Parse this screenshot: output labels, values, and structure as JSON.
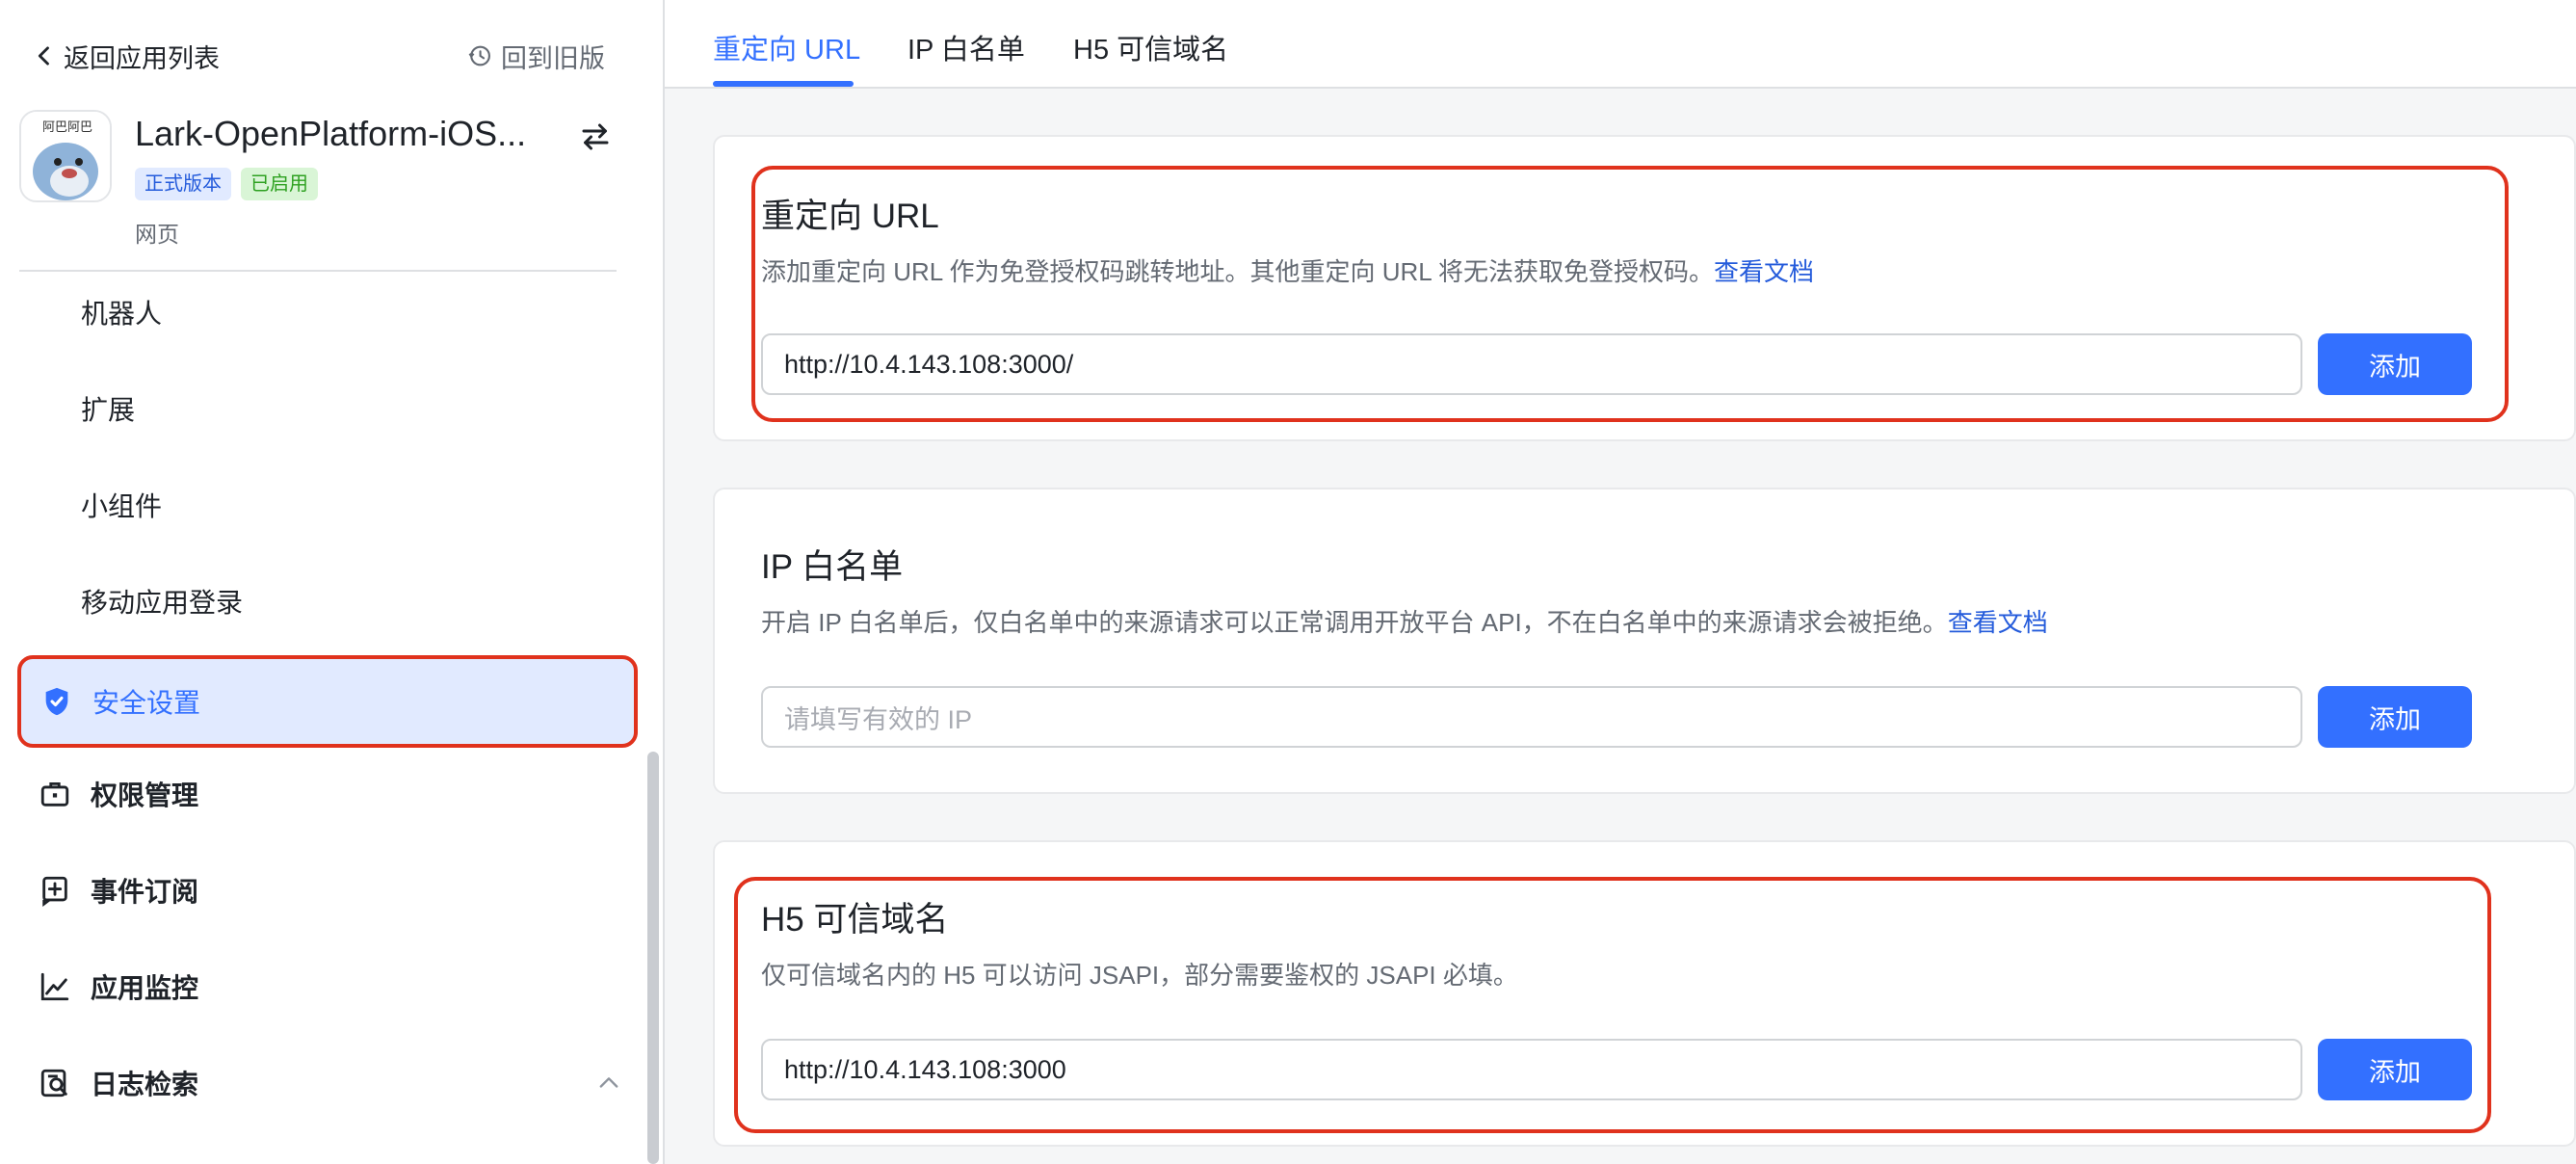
{
  "sidebar": {
    "back_label": "返回应用列表",
    "old_version_label": "回到旧版",
    "app": {
      "name": "Lark-OpenPlatform-iOS...",
      "badge_release": "正式版本",
      "badge_enabled": "已启用",
      "type": "网页"
    },
    "items": [
      {
        "label": "机器人"
      },
      {
        "label": "扩展"
      },
      {
        "label": "小组件"
      },
      {
        "label": "移动应用登录"
      },
      {
        "label": "安全设置",
        "icon": "shield-check-icon",
        "active": true
      },
      {
        "label": "权限管理",
        "icon": "briefcase-icon"
      },
      {
        "label": "事件订阅",
        "icon": "event-add-icon"
      },
      {
        "label": "应用监控",
        "icon": "line-chart-icon"
      },
      {
        "label": "日志检索",
        "icon": "log-search-icon",
        "expanded": true
      }
    ]
  },
  "tabs": [
    {
      "label": "重定向 URL",
      "active": true
    },
    {
      "label": "IP 白名单"
    },
    {
      "label": "H5 可信域名"
    }
  ],
  "sections": {
    "redirect": {
      "title": "重定向 URL",
      "desc": "添加重定向 URL 作为免登授权码跳转地址。其他重定向 URL 将无法获取免登授权码。",
      "link": "查看文档",
      "value": "http://10.4.143.108:3000/",
      "button": "添加"
    },
    "ip": {
      "title": "IP 白名单",
      "desc": "开启 IP 白名单后，仅白名单中的来源请求可以正常调用开放平台 API，不在白名单中的来源请求会被拒绝。",
      "link": "查看文档",
      "placeholder": "请填写有效的 IP",
      "button": "添加"
    },
    "h5": {
      "title": "H5 可信域名",
      "desc": "仅可信域名内的 H5 可以访问 JSAPI，部分需要鉴权的 JSAPI 必填。",
      "value": "http://10.4.143.108:3000",
      "button": "添加"
    }
  },
  "colors": {
    "accent": "#3370ff",
    "highlight": "#e0321d",
    "active_bg": "#e1eaff"
  }
}
